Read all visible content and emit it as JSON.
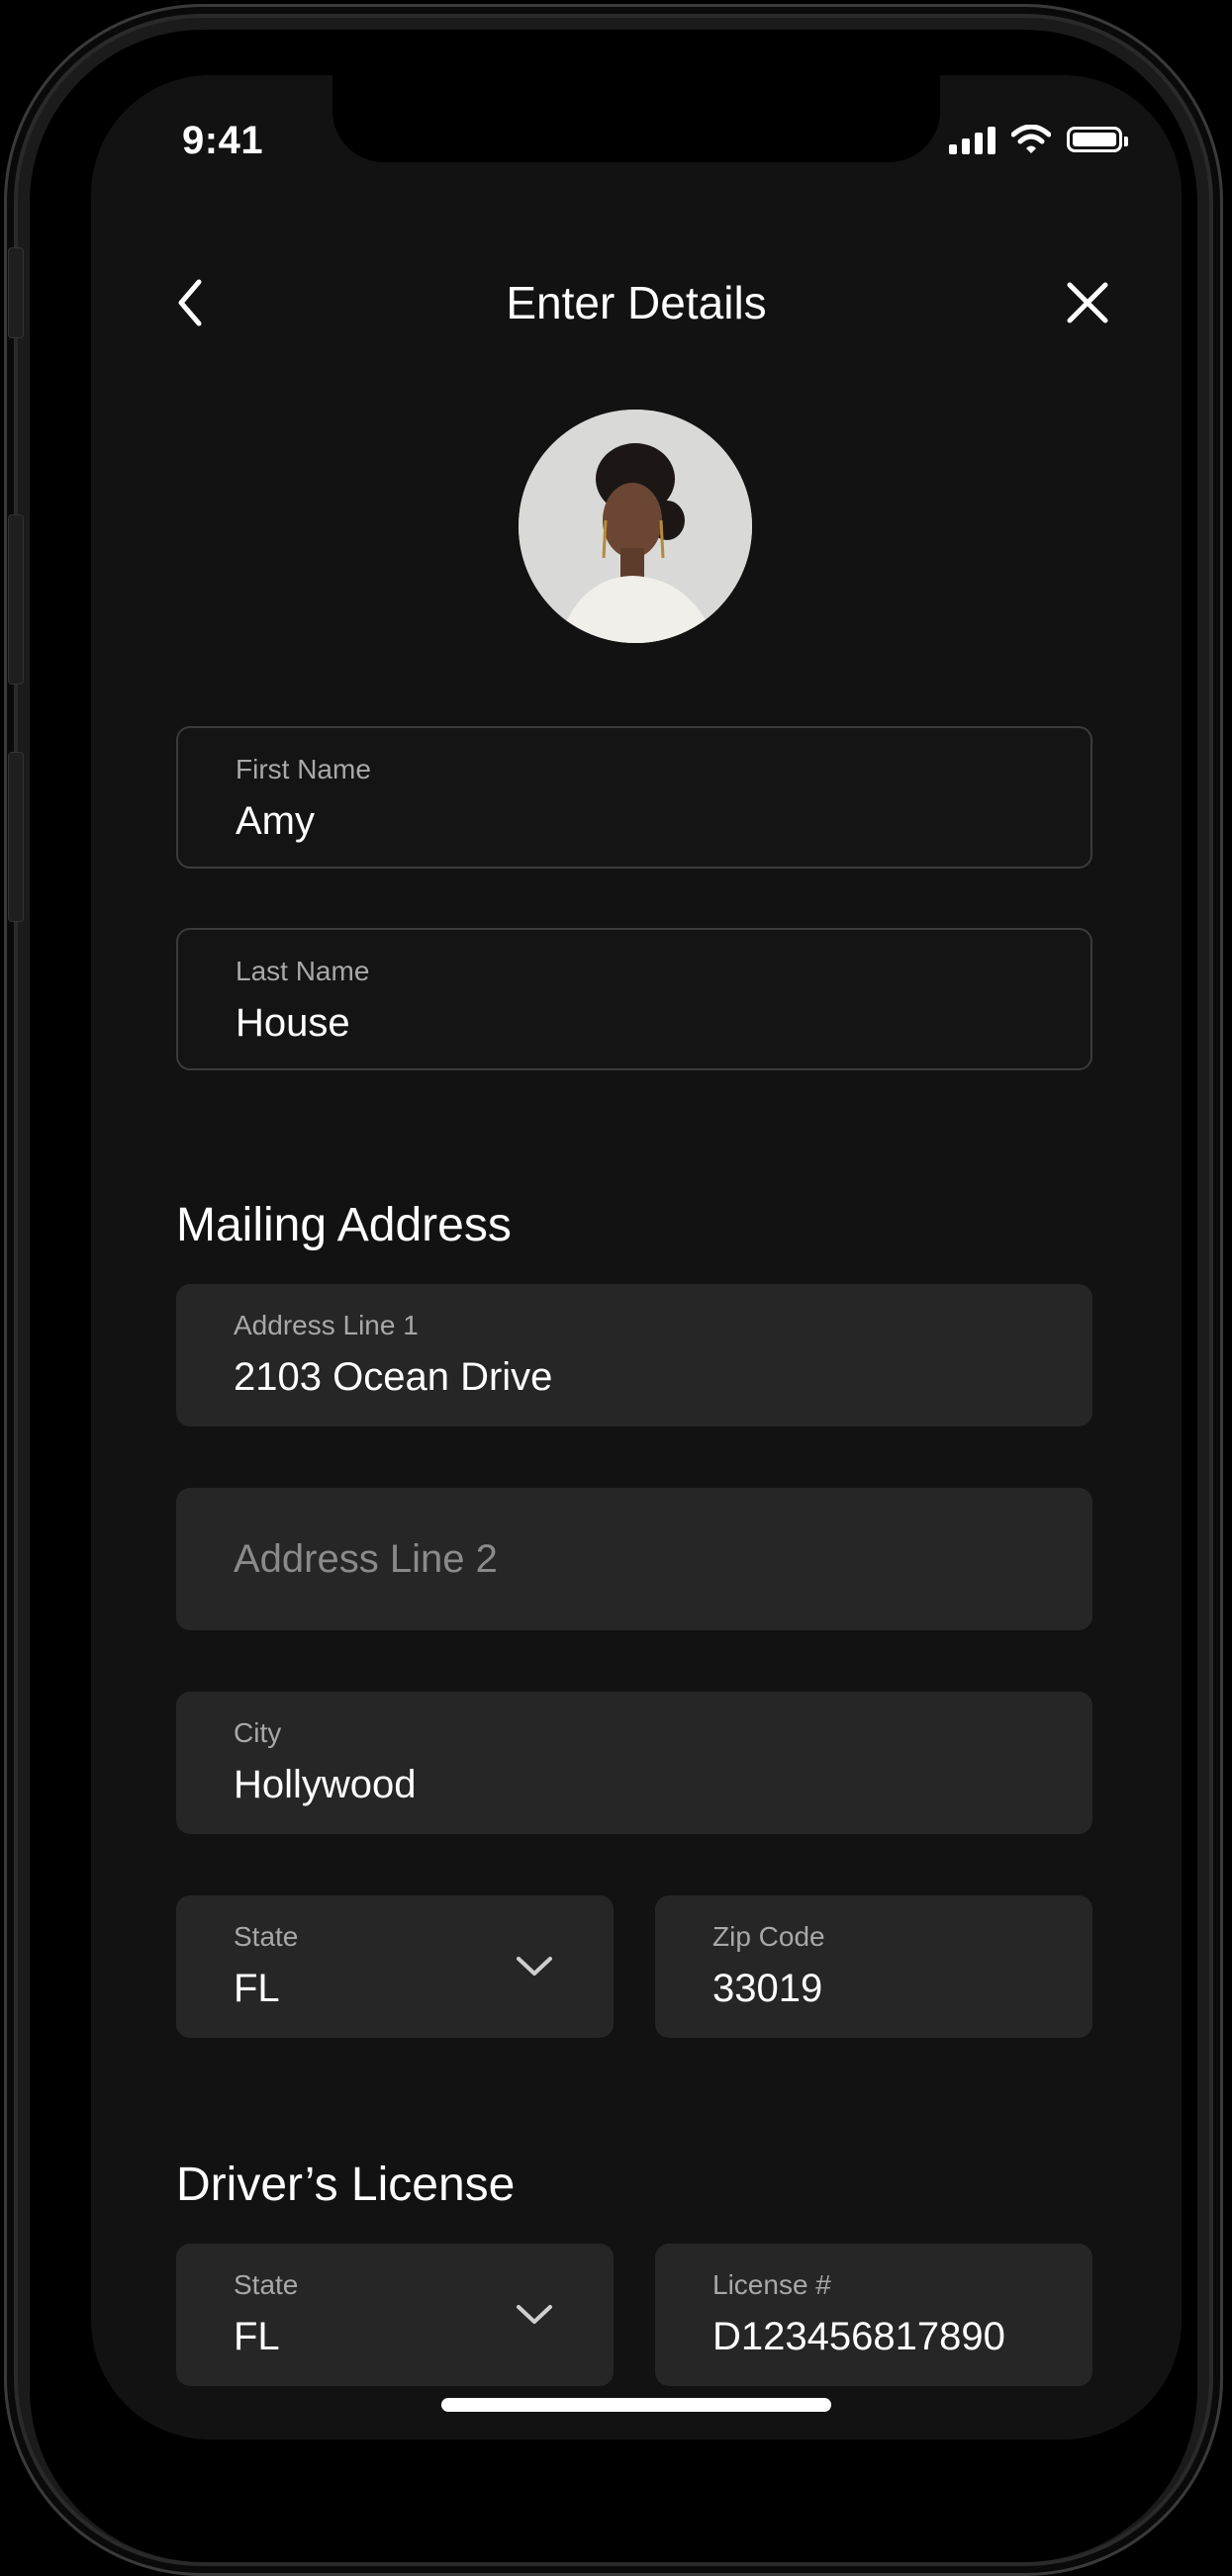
{
  "status_bar": {
    "time": "9:41"
  },
  "nav": {
    "title": "Enter Details"
  },
  "form": {
    "first_name": {
      "label": "First Name",
      "value": "Amy"
    },
    "last_name": {
      "label": "Last Name",
      "value": "House"
    },
    "mailing_section_title": "Mailing Address",
    "address_line1": {
      "label": "Address Line 1",
      "value": "2103 Ocean Drive"
    },
    "address_line2": {
      "placeholder": "Address Line 2"
    },
    "city": {
      "label": "City",
      "value": "Hollywood"
    },
    "mailing_state": {
      "label": "State",
      "value": "FL"
    },
    "zip": {
      "label": "Zip Code",
      "value": "33019"
    },
    "license_section_title": "Driver’s License",
    "license_state": {
      "label": "State",
      "value": "FL"
    },
    "license_number": {
      "label": "License #",
      "value": "D123456817890"
    }
  },
  "icons": {
    "back": "chevron-left-icon",
    "close": "close-icon",
    "dropdown": "chevron-down-icon",
    "signal": "cellular-signal-icon",
    "wifi": "wifi-icon",
    "battery": "battery-icon"
  },
  "colors": {
    "background": "#121212",
    "field_filled": "#262626",
    "field_outline": "#3b3b3b",
    "label": "#a8a8a8",
    "text": "#ffffff"
  }
}
